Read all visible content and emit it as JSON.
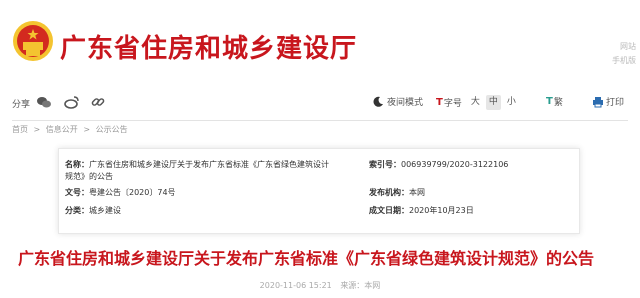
{
  "header": {
    "title": "广东省住房和城乡建设厅",
    "corner_lines": [
      "网站",
      "手机版"
    ]
  },
  "toolbar": {
    "share_label": "分享",
    "night_mode": "夜间模式",
    "font_label": "字号",
    "size_large": "大",
    "size_medium": "中",
    "size_small": "小",
    "traditional": "繁",
    "print": "打印"
  },
  "breadcrumb": {
    "items": [
      "首页",
      "信息公开",
      "公示公告"
    ],
    "separator": ">"
  },
  "info": {
    "name_label": "名称：",
    "name_value_line1": "广东省住房和城乡建设厅关于发布广东省标准《广东省绿色建筑设计",
    "name_value_line2": "规范》的公告",
    "index_label": "索引号：",
    "index_value": "006939799/2020-3122106",
    "docno_label": "文号：",
    "docno_value": "粤建公告〔2020〕74号",
    "publisher_label": "发布机构：",
    "publisher_value": "本网",
    "category_label": "分类：",
    "category_value": "城乡建设",
    "date_label": "成文日期：",
    "date_value": "2020年10月23日"
  },
  "article": {
    "title": "广东省住房和城乡建设厅关于发布广东省标准《广东省绿色建筑设计规范》的公告",
    "meta_date": "2020-11-06 15:21",
    "meta_source": "来源：本网"
  },
  "colors": {
    "brand_red": "#c8161d",
    "gold": "#f4c430"
  }
}
